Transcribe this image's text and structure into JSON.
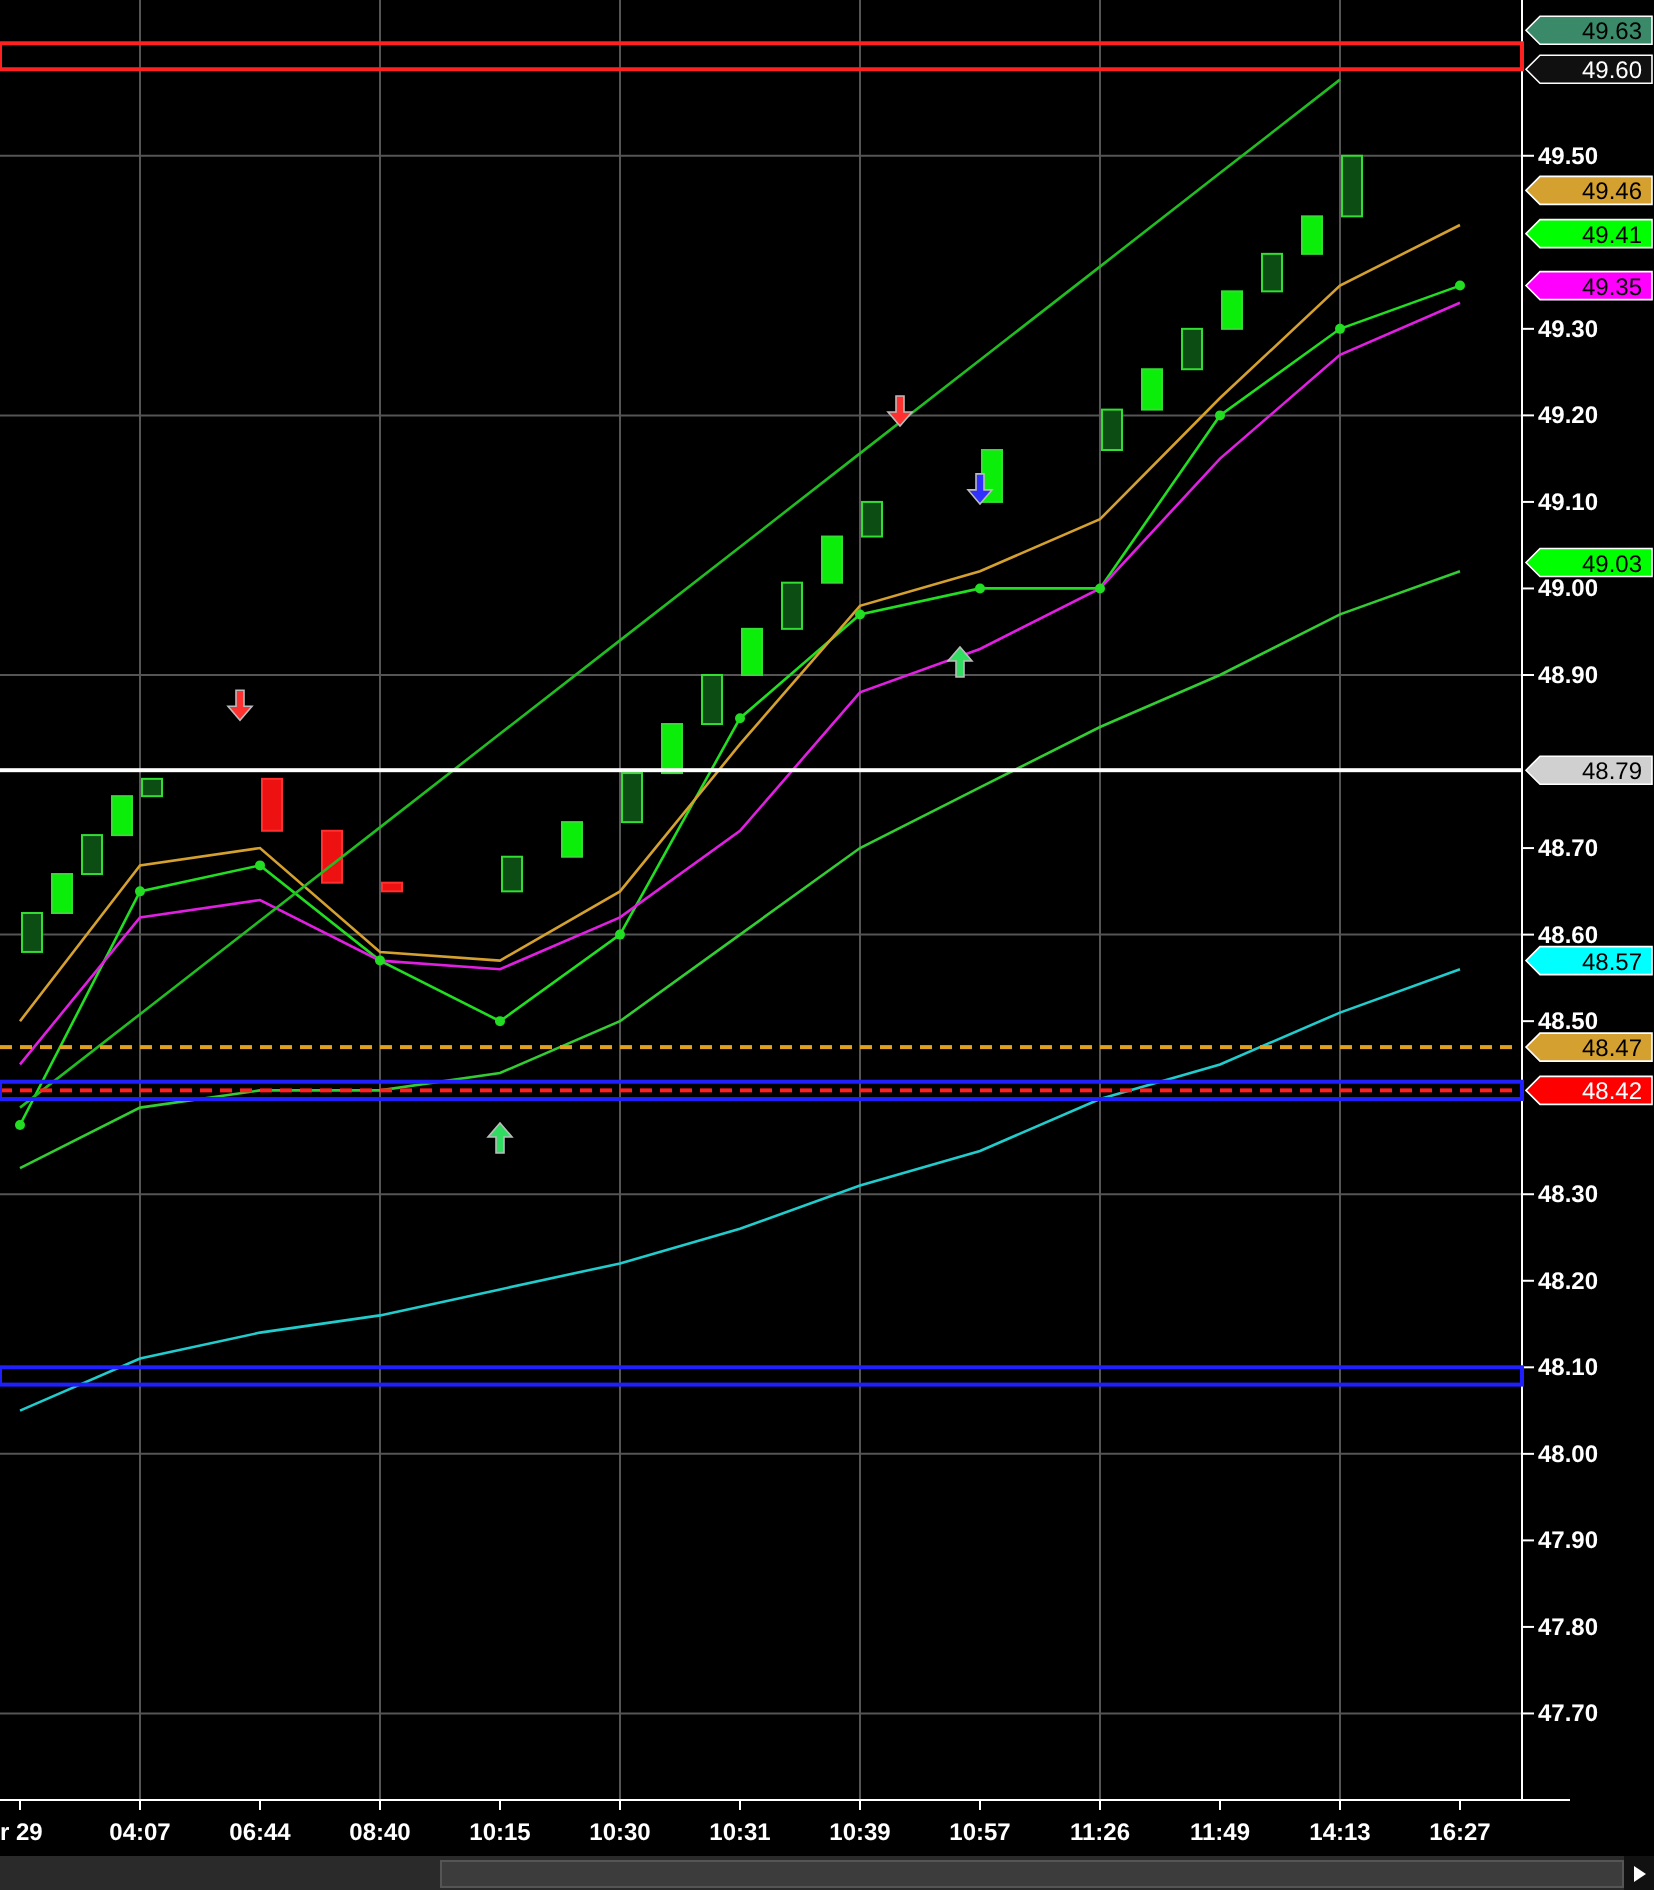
{
  "chart": {
    "chart_data": {
      "type": "line",
      "categories": [
        "r 29",
        "04:07",
        "06:44",
        "08:40",
        "10:15",
        "10:30",
        "10:31",
        "10:39",
        "10:57",
        "11:26",
        "11:49",
        "14:13",
        "16:27"
      ],
      "ylim": [
        47.6,
        49.68
      ],
      "yticks": [
        {
          "value": 47.7,
          "label": "47.70"
        },
        {
          "value": 47.8,
          "label": "47.80"
        },
        {
          "value": 47.9,
          "label": "47.90"
        },
        {
          "value": 48.0,
          "label": "48.00"
        },
        {
          "value": 48.1,
          "label": "48.10"
        },
        {
          "value": 48.2,
          "label": "48.20"
        },
        {
          "value": 48.3,
          "label": "48.30"
        },
        {
          "value": 48.5,
          "label": "48.50"
        },
        {
          "value": 48.6,
          "label": "48.60"
        },
        {
          "value": 48.7,
          "label": "48.70"
        },
        {
          "value": 48.9,
          "label": "48.90"
        },
        {
          "value": 49.0,
          "label": "49.00"
        },
        {
          "value": 49.1,
          "label": "49.10"
        },
        {
          "value": 49.2,
          "label": "49.20"
        },
        {
          "value": 49.3,
          "label": "49.30"
        },
        {
          "value": 49.5,
          "label": "49.50"
        }
      ],
      "series": [
        {
          "color": "#22dd22",
          "marker": "o",
          "values": [
            48.38,
            48.65,
            48.68,
            48.57,
            48.5,
            48.6,
            48.85,
            48.97,
            49.0,
            49.0,
            49.2,
            49.3,
            49.35
          ]
        },
        {
          "color": "#d4a030",
          "values": [
            48.5,
            48.68,
            48.7,
            48.58,
            48.57,
            48.65,
            48.82,
            48.98,
            49.02,
            49.08,
            49.22,
            49.35,
            49.42
          ]
        },
        {
          "color": "#e020e0",
          "values": [
            48.45,
            48.62,
            48.64,
            48.57,
            48.56,
            48.62,
            48.72,
            48.88,
            48.93,
            49.0,
            49.15,
            49.27,
            49.33
          ]
        },
        {
          "color": "#33cc33",
          "values": [
            48.33,
            48.4,
            48.42,
            48.42,
            48.44,
            48.5,
            48.6,
            48.7,
            48.77,
            48.84,
            48.9,
            48.97,
            49.02
          ]
        },
        {
          "color": "#22cccc",
          "values": [
            48.05,
            48.11,
            48.14,
            48.16,
            48.19,
            48.22,
            48.26,
            48.31,
            48.35,
            48.41,
            48.45,
            48.51,
            48.56
          ]
        },
        {
          "color": "#22bb22",
          "values": [
            48.4,
            48.508,
            48.616,
            48.724,
            48.832,
            48.94,
            49.048,
            49.156,
            49.264,
            49.372,
            49.48,
            49.588,
            null
          ]
        }
      ],
      "grid": true
    },
    "level_lines": [
      {
        "color": "#ffffff"
      },
      {
        "color": "#e0a020"
      },
      {
        "color": "#ff2020"
      }
    ],
    "zones": [
      {
        "color": "#ff2020"
      },
      {
        "color": "#2020ff"
      },
      {
        "color": "#2020ff"
      }
    ],
    "signal_arrows": [
      {
        "kind": "down",
        "color": "#ff3030"
      },
      {
        "kind": "down",
        "color": "#ff3030"
      },
      {
        "kind": "down",
        "color": "#3030ff"
      },
      {
        "kind": "up",
        "color": "#30dd60"
      },
      {
        "kind": "up",
        "color": "#30dd60"
      }
    ],
    "price_tags": [
      {
        "label": "49.63",
        "color": "#3a8a6a"
      },
      {
        "label": "49.60",
        "color": "#101010"
      },
      {
        "label": "49.46",
        "color": "#d4a030"
      },
      {
        "label": "49.41",
        "color": "#00ff00"
      },
      {
        "label": "49.35",
        "color": "#ff00ff"
      },
      {
        "label": "49.03",
        "color": "#00ff00"
      },
      {
        "label": "48.79",
        "color": "#d0d0d0"
      },
      {
        "label": "48.57",
        "color": "#00ffff"
      },
      {
        "label": "48.47",
        "color": "#d4a030"
      },
      {
        "label": "48.42",
        "color": "#ff0000"
      }
    ]
  }
}
